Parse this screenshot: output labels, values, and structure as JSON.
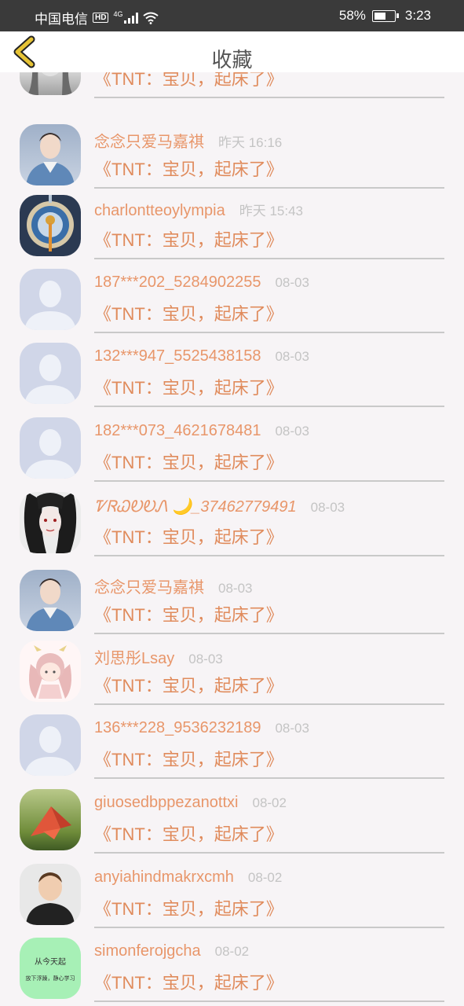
{
  "status_bar": {
    "carrier": "中国电信",
    "hd": "HD",
    "signal": "4G",
    "battery": "58%",
    "battery_level": 0.58,
    "time": "3:23"
  },
  "header": {
    "title": "收藏"
  },
  "items": [
    {
      "name": "",
      "time": "",
      "message": "《TNT：宝贝，起床了》",
      "avatar": "photo-woman"
    },
    {
      "name": "念念只爱马嘉祺",
      "time": "昨天 16:16",
      "message": "《TNT：宝贝，起床了》",
      "avatar": "photo-boy-denim"
    },
    {
      "name": "charlontteoylympia",
      "time": "昨天 15:43",
      "message": "《TNT：宝贝，起床了》",
      "avatar": "photo-ornament"
    },
    {
      "name": "187***202_5284902255",
      "time": "08-03",
      "message": "《TNT：宝贝，起床了》",
      "avatar": "default-user"
    },
    {
      "name": "132***947_5525438158",
      "time": "08-03",
      "message": "《TNT：宝贝，起床了》",
      "avatar": "default-user"
    },
    {
      "name": "182***073_4621678481",
      "time": "08-03",
      "message": "《TNT：宝贝，起床了》",
      "avatar": "default-user"
    },
    {
      "name": "ᏤᏒᏇᎧᎧᏁ 🌙_37462779491",
      "time": "08-03",
      "message": "《TNT：宝贝，起床了》",
      "avatar": "photo-anime-dark"
    },
    {
      "name": "念念只爱马嘉祺",
      "time": "08-03",
      "message": "《TNT：宝贝，起床了》",
      "avatar": "photo-boy-denim"
    },
    {
      "name": "刘思彤Lsay",
      "time": "08-03",
      "message": "《TNT：宝贝，起床了》",
      "avatar": "cartoon-girl"
    },
    {
      "name": "136***228_9536232189",
      "time": "08-03",
      "message": "《TNT：宝贝，起床了》",
      "avatar": "default-user"
    },
    {
      "name": "giuosedbppezanottxi",
      "time": "08-02",
      "message": "《TNT：宝贝，起床了》",
      "avatar": "photo-paper-crane"
    },
    {
      "name": "anyiahindmakrxcmh",
      "time": "08-02",
      "message": "《TNT：宝贝，起床了》",
      "avatar": "photo-child"
    },
    {
      "name": "simonferojgcha",
      "time": "08-02",
      "message": "《TNT：宝贝，起床了》",
      "avatar": "green-text-card",
      "avatar_text_1": "从今天起",
      "avatar_text_2": "放下浮躁，静心学习"
    }
  ],
  "colors": {
    "name": "#e8966a",
    "message": "#e08b5c",
    "time": "#c4c4c4",
    "divider": "#c9c9c9",
    "background": "#f7f4f6",
    "back_arrow": "#e6c335"
  }
}
